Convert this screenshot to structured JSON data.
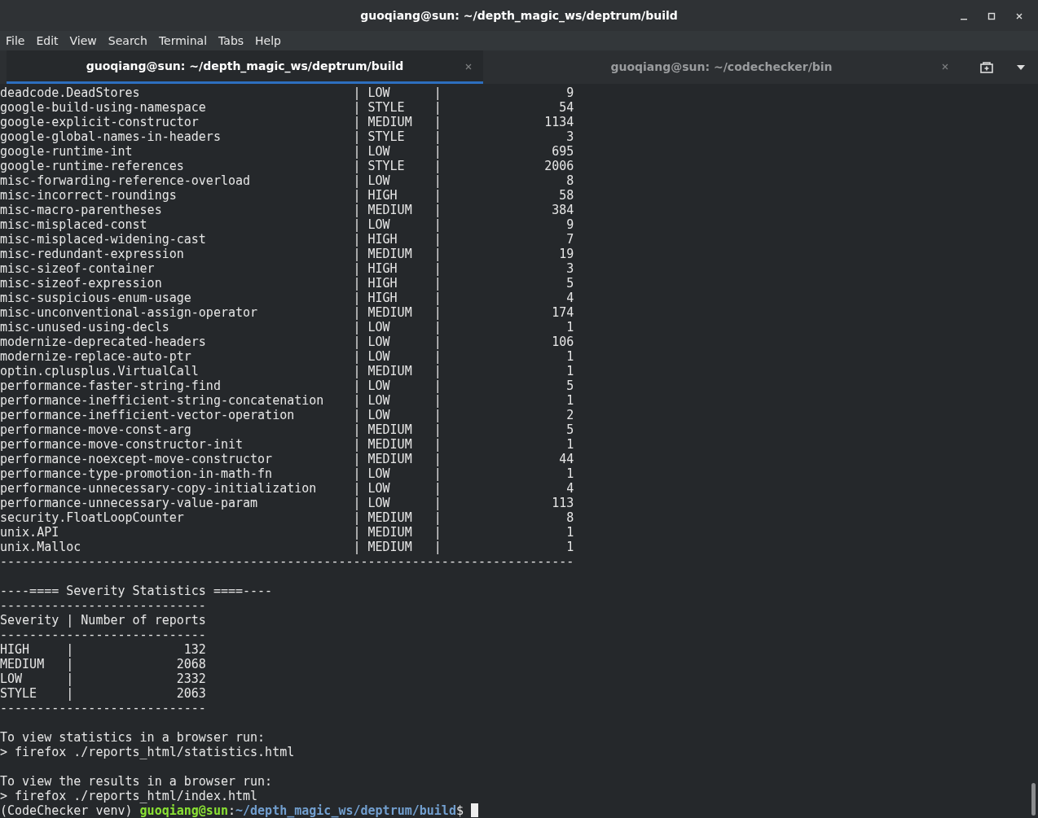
{
  "window": {
    "title": "guoqiang@sun: ~/depth_magic_ws/deptrum/build"
  },
  "menu": [
    "File",
    "Edit",
    "View",
    "Search",
    "Terminal",
    "Tabs",
    "Help"
  ],
  "tabs": [
    {
      "label": "guoqiang@sun: ~/depth_magic_ws/deptrum/build",
      "selected": true
    },
    {
      "label": "guoqiang@sun: ~/codechecker/bin",
      "selected": false
    }
  ],
  "terminal": {
    "lines": [
      {
        "kind": "checker",
        "cells": [
          "deadcode.DeadStores",
          "|",
          "LOW",
          "|",
          "9"
        ]
      },
      {
        "kind": "checker",
        "cells": [
          "google-build-using-namespace",
          "|",
          "STYLE",
          "|",
          "54"
        ]
      },
      {
        "kind": "checker",
        "cells": [
          "google-explicit-constructor",
          "|",
          "MEDIUM",
          "|",
          "1134"
        ]
      },
      {
        "kind": "checker",
        "cells": [
          "google-global-names-in-headers",
          "|",
          "STYLE",
          "|",
          "3"
        ]
      },
      {
        "kind": "checker",
        "cells": [
          "google-runtime-int",
          "|",
          "LOW",
          "|",
          "695"
        ]
      },
      {
        "kind": "checker",
        "cells": [
          "google-runtime-references",
          "|",
          "STYLE",
          "|",
          "2006"
        ]
      },
      {
        "kind": "checker",
        "cells": [
          "misc-forwarding-reference-overload",
          "|",
          "LOW",
          "|",
          "8"
        ]
      },
      {
        "kind": "checker",
        "cells": [
          "misc-incorrect-roundings",
          "|",
          "HIGH",
          "|",
          "58"
        ]
      },
      {
        "kind": "checker",
        "cells": [
          "misc-macro-parentheses",
          "|",
          "MEDIUM",
          "|",
          "384"
        ]
      },
      {
        "kind": "checker",
        "cells": [
          "misc-misplaced-const",
          "|",
          "LOW",
          "|",
          "9"
        ]
      },
      {
        "kind": "checker",
        "cells": [
          "misc-misplaced-widening-cast",
          "|",
          "HIGH",
          "|",
          "7"
        ]
      },
      {
        "kind": "checker",
        "cells": [
          "misc-redundant-expression",
          "|",
          "MEDIUM",
          "|",
          "19"
        ]
      },
      {
        "kind": "checker",
        "cells": [
          "misc-sizeof-container",
          "|",
          "HIGH",
          "|",
          "3"
        ]
      },
      {
        "kind": "checker",
        "cells": [
          "misc-sizeof-expression",
          "|",
          "HIGH",
          "|",
          "5"
        ]
      },
      {
        "kind": "checker",
        "cells": [
          "misc-suspicious-enum-usage",
          "|",
          "HIGH",
          "|",
          "4"
        ]
      },
      {
        "kind": "checker",
        "cells": [
          "misc-unconventional-assign-operator",
          "|",
          "MEDIUM",
          "|",
          "174"
        ]
      },
      {
        "kind": "checker",
        "cells": [
          "misc-unused-using-decls",
          "|",
          "LOW",
          "|",
          "1"
        ]
      },
      {
        "kind": "checker",
        "cells": [
          "modernize-deprecated-headers",
          "|",
          "LOW",
          "|",
          "106"
        ]
      },
      {
        "kind": "checker",
        "cells": [
          "modernize-replace-auto-ptr",
          "|",
          "LOW",
          "|",
          "1"
        ]
      },
      {
        "kind": "checker",
        "cells": [
          "optin.cplusplus.VirtualCall",
          "|",
          "MEDIUM",
          "|",
          "1"
        ]
      },
      {
        "kind": "checker",
        "cells": [
          "performance-faster-string-find",
          "|",
          "LOW",
          "|",
          "5"
        ]
      },
      {
        "kind": "checker",
        "cells": [
          "performance-inefficient-string-concatenation",
          "|",
          "LOW",
          "|",
          "1"
        ]
      },
      {
        "kind": "checker",
        "cells": [
          "performance-inefficient-vector-operation",
          "|",
          "LOW",
          "|",
          "2"
        ]
      },
      {
        "kind": "checker",
        "cells": [
          "performance-move-const-arg",
          "|",
          "MEDIUM",
          "|",
          "5"
        ]
      },
      {
        "kind": "checker",
        "cells": [
          "performance-move-constructor-init",
          "|",
          "MEDIUM",
          "|",
          "1"
        ]
      },
      {
        "kind": "checker",
        "cells": [
          "performance-noexcept-move-constructor",
          "|",
          "MEDIUM",
          "|",
          "44"
        ]
      },
      {
        "kind": "checker",
        "cells": [
          "performance-type-promotion-in-math-fn",
          "|",
          "LOW",
          "|",
          "1"
        ]
      },
      {
        "kind": "checker",
        "cells": [
          "performance-unnecessary-copy-initialization",
          "|",
          "LOW",
          "|",
          "4"
        ]
      },
      {
        "kind": "checker",
        "cells": [
          "performance-unnecessary-value-param",
          "|",
          "LOW",
          "|",
          "113"
        ]
      },
      {
        "kind": "checker",
        "cells": [
          "security.FloatLoopCounter",
          "|",
          "MEDIUM",
          "|",
          "8"
        ]
      },
      {
        "kind": "checker",
        "cells": [
          "unix.API",
          "|",
          "MEDIUM",
          "|",
          "1"
        ]
      },
      {
        "kind": "checker",
        "cells": [
          "unix.Malloc",
          "|",
          "MEDIUM",
          "|",
          "1"
        ]
      },
      {
        "kind": "text",
        "text": "------------------------------------------------------------------------------"
      },
      {
        "kind": "blank"
      },
      {
        "kind": "text",
        "text": "----==== Severity Statistics ====----"
      },
      {
        "kind": "text",
        "text": "----------------------------"
      },
      {
        "kind": "text",
        "text": "Severity | Number of reports"
      },
      {
        "kind": "text",
        "text": "----------------------------"
      },
      {
        "kind": "severity",
        "cells": [
          "HIGH",
          "|",
          "132"
        ]
      },
      {
        "kind": "severity",
        "cells": [
          "MEDIUM",
          "|",
          "2068"
        ]
      },
      {
        "kind": "severity",
        "cells": [
          "LOW",
          "|",
          "2332"
        ]
      },
      {
        "kind": "severity",
        "cells": [
          "STYLE",
          "|",
          "2063"
        ]
      },
      {
        "kind": "text",
        "text": "----------------------------"
      },
      {
        "kind": "blank"
      },
      {
        "kind": "text",
        "text": "To view statistics in a browser run:"
      },
      {
        "kind": "text",
        "text": "> firefox ./reports_html/statistics.html"
      },
      {
        "kind": "blank"
      },
      {
        "kind": "text",
        "text": "To view the results in a browser run:"
      },
      {
        "kind": "text",
        "text": "> firefox ./reports_html/index.html"
      }
    ],
    "prompt": {
      "env": "(CodeChecker venv)",
      "user_host": "guoqiang@sun",
      "separator": ":",
      "path": "~/depth_magic_ws/deptrum/build",
      "symbol": "$"
    }
  }
}
